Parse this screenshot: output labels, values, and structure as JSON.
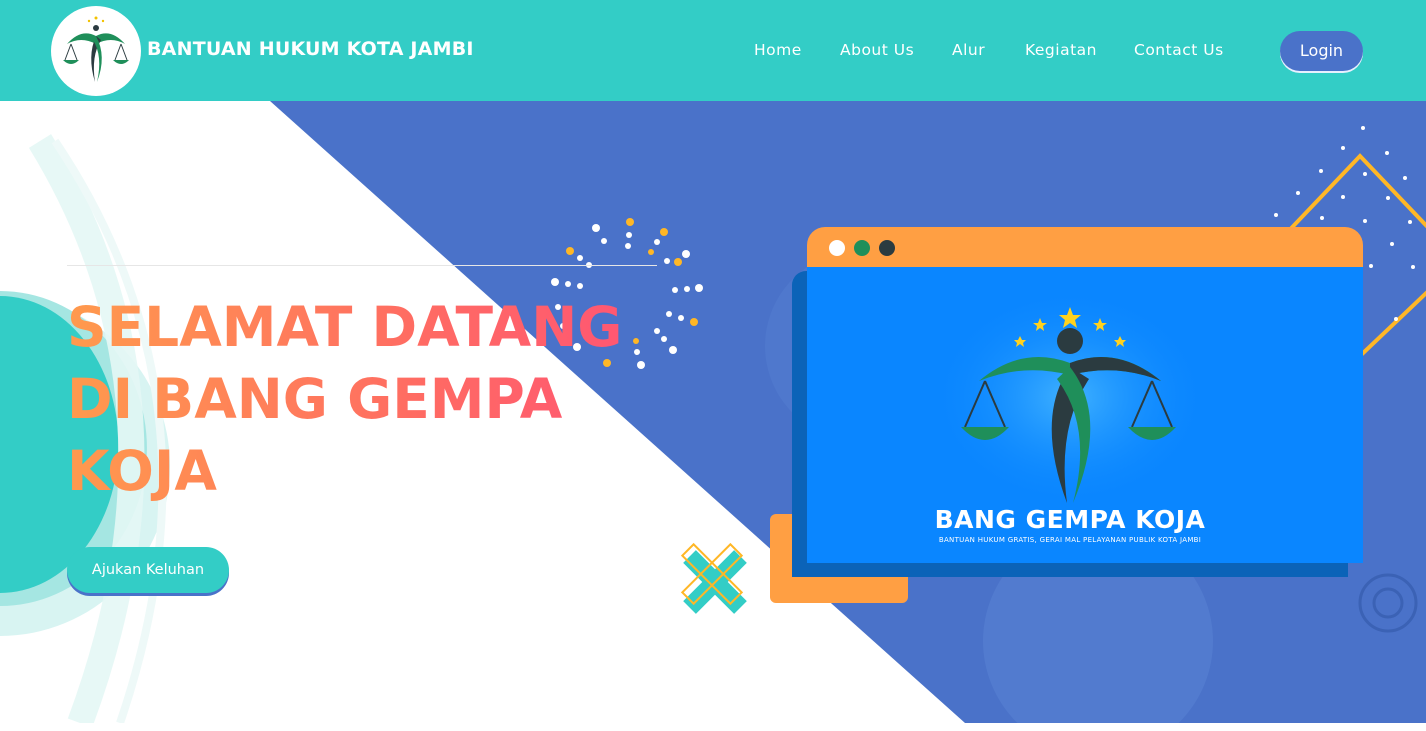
{
  "header": {
    "brand": "BANTUAN HUKUM KOTA JAMBI",
    "nav": [
      "Home",
      "About Us",
      "Alur",
      "Kegiatan",
      "Contact Us"
    ],
    "login_label": "Login"
  },
  "hero": {
    "title_lines": [
      "SELAMAT DATANG",
      "DI BANG GEMPA",
      "KOJA"
    ],
    "cta_label": "Ajukan Keluhan"
  },
  "screen": {
    "title": "BANG GEMPA KOJA",
    "subtitle": "BANTUAN HUKUM GRATIS, GERAI MAL PELAYANAN PUBLIK KOTA JAMBI"
  },
  "icons": {
    "logo": "scales-of-justice-logo-icon",
    "browser_dots": [
      "window-dot-white",
      "window-dot-green",
      "window-dot-dark"
    ]
  },
  "colors": {
    "header_bg": "#33cdc6",
    "accent_blue": "#4a72c9",
    "title_gradient_start": "#ff9a4d",
    "title_gradient_end": "#ff4f78",
    "browser_bar": "#ff9f43",
    "browser_screen": "#0a86ff"
  }
}
